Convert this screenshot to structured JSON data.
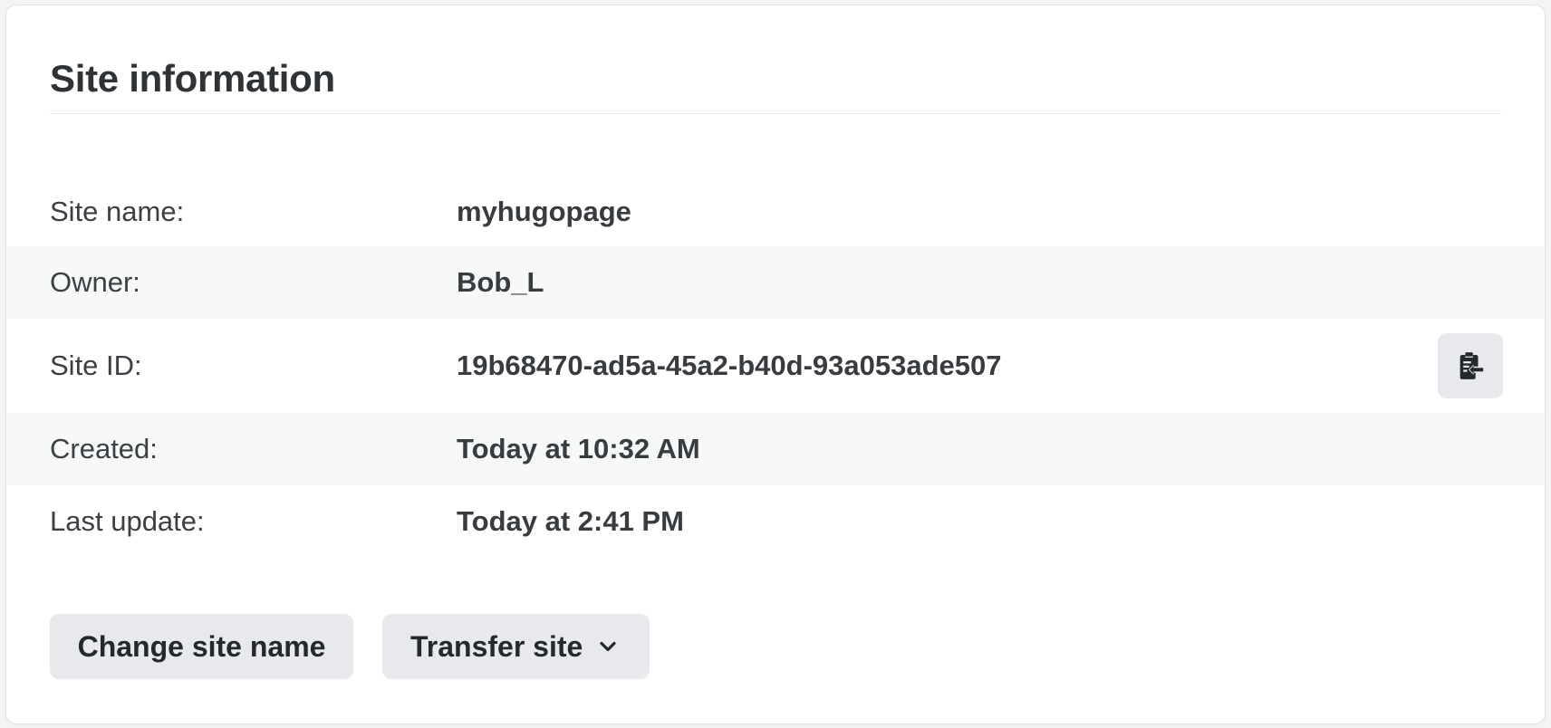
{
  "card": {
    "title": "Site information"
  },
  "info": {
    "rows": [
      {
        "label": "Site name:",
        "value": "myhugopage"
      },
      {
        "label": "Owner:",
        "value": "Bob_L"
      },
      {
        "label": "Site ID:",
        "value": "19b68470-ad5a-45a2-b40d-93a053ade507"
      },
      {
        "label": "Created:",
        "value": "Today at 10:32 AM"
      },
      {
        "label": "Last update:",
        "value": "Today at 2:41 PM"
      }
    ],
    "copy_icon": "clipboard-copy-icon"
  },
  "actions": {
    "change_name_label": "Change site name",
    "transfer_label": "Transfer site",
    "transfer_icon": "chevron-down-icon"
  },
  "colors": {
    "card_background": "#ffffff",
    "stripe": "#f7f8f8",
    "button_background": "#e8e9ec",
    "text": "#2f3338"
  }
}
